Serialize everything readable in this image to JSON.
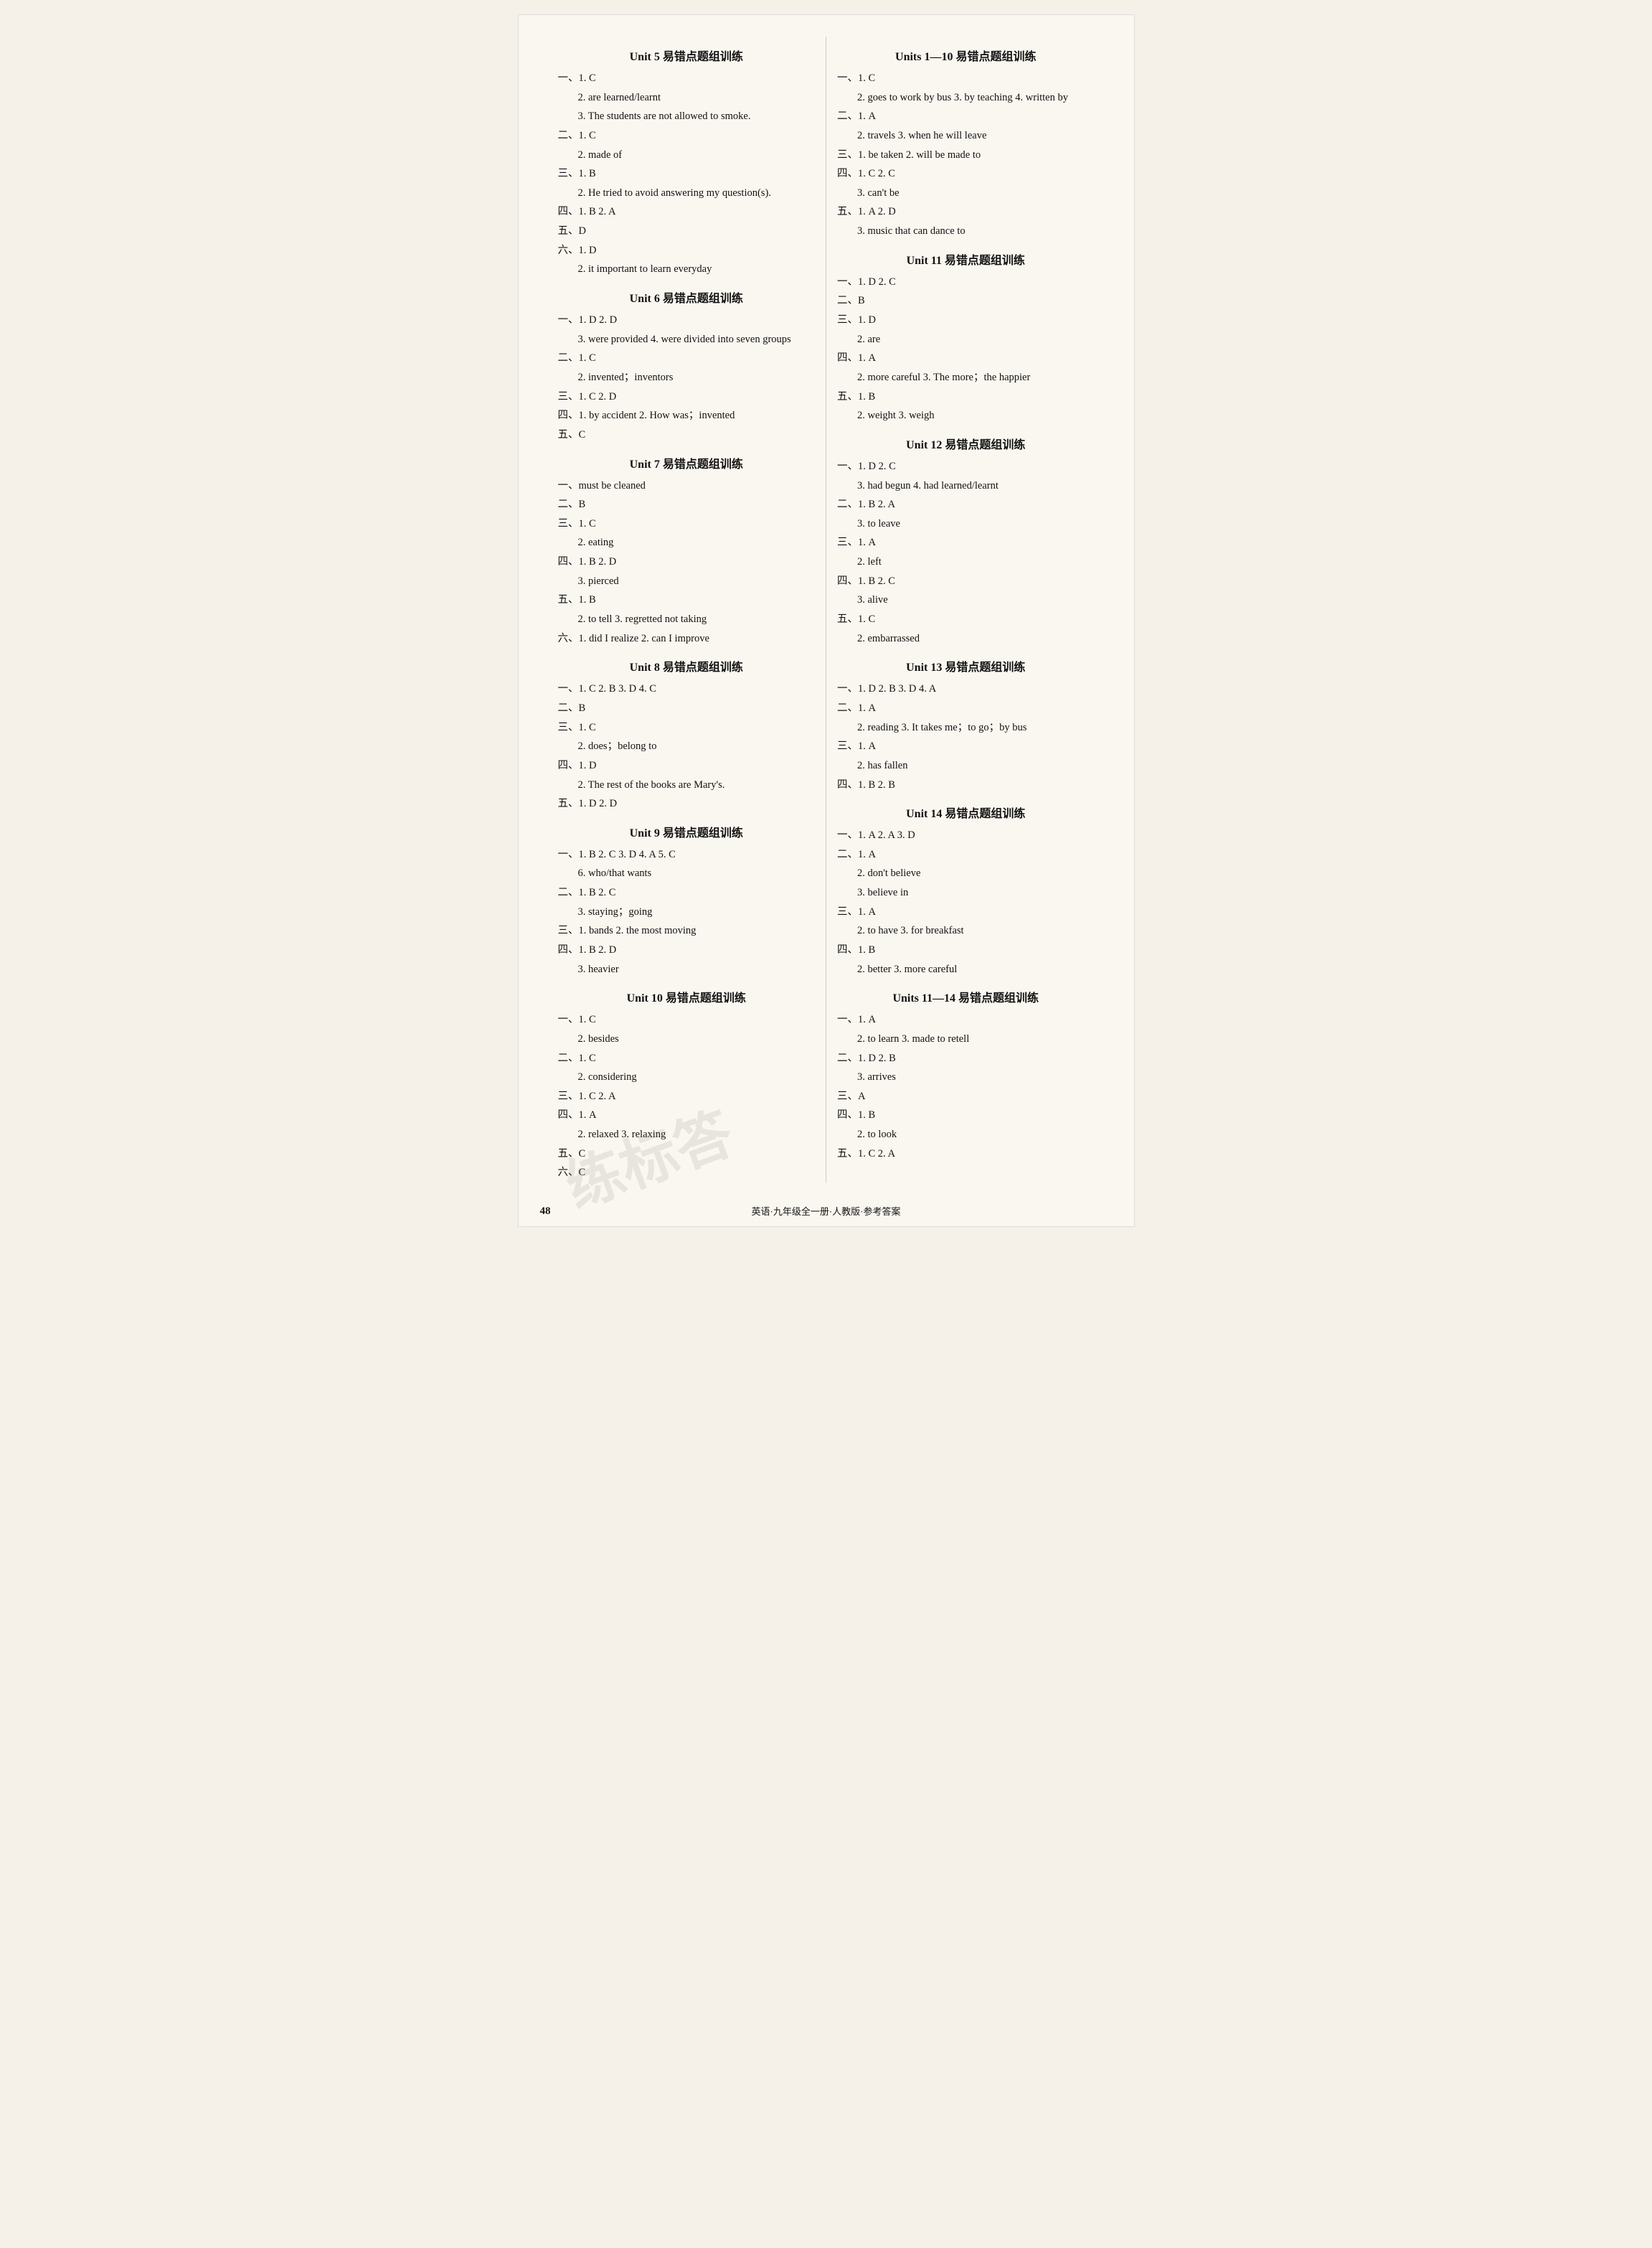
{
  "page": {
    "number": "48",
    "footer": "英语·九年级全一册·人教版·参考答案"
  },
  "left_column": {
    "sections": [
      {
        "title": "Unit 5 易错点题组训练",
        "entries": [
          "一、1. C",
          "2. are learned/learnt",
          "3. The students are not allowed to smoke.",
          "二、1. C",
          "2. made of",
          "三、1. B",
          "2. He tried to avoid answering my question(s).",
          "四、1. B  2. A",
          "五、D",
          "六、1. D",
          "2. it important to learn everyday"
        ]
      },
      {
        "title": "Unit 6 易错点题组训练",
        "entries": [
          "一、1. D  2. D",
          "3. were provided  4. were divided into seven groups",
          "二、1. C",
          "2. invented；inventors",
          "三、1. C  2. D",
          "四、1. by accident  2. How was；invented",
          "五、C"
        ]
      },
      {
        "title": "Unit 7 易错点题组训练",
        "entries": [
          "一、must be cleaned",
          "二、B",
          "三、1. C",
          "2. eating",
          "四、1. B  2. D",
          "3. pierced",
          "五、1. B",
          "2. to tell  3. regretted not taking",
          "六、1. did I realize  2. can I improve"
        ]
      },
      {
        "title": "Unit 8 易错点题组训练",
        "entries": [
          "一、1. C  2. B  3. D  4. C",
          "二、B",
          "三、1. C",
          "2. does；belong to",
          "四、1. D",
          "2. The rest of the books are Mary's.",
          "五、1. D  2. D"
        ]
      },
      {
        "title": "Unit 9 易错点题组训练",
        "entries": [
          "一、1. B  2. C  3. D  4. A  5. C",
          "6. who/that wants",
          "二、1. B  2. C",
          "3. staying；going",
          "三、1. bands  2. the most moving",
          "四、1. B  2. D",
          "3. heavier"
        ]
      },
      {
        "title": "Unit 10 易错点题组训练",
        "entries": [
          "一、1. C",
          "2. besides",
          "二、1. C",
          "2. considering",
          "三、1. C  2. A",
          "四、1. A",
          "2. relaxed  3. relaxing",
          "五、C",
          "六、C"
        ]
      }
    ]
  },
  "right_column": {
    "sections": [
      {
        "title": "Units 1—10 易错点题组训练",
        "entries": [
          "一、1. C",
          "2. goes to work by bus  3. by teaching  4. written by",
          "二、1. A",
          "2. travels  3. when he will leave",
          "三、1. be taken  2. will be made to",
          "四、1. C  2. C",
          "3. can't be",
          "五、1. A  2. D",
          "3. music that can dance to"
        ]
      },
      {
        "title": "Unit 11 易错点题组训练",
        "entries": [
          "一、1. D  2. C",
          "二、B",
          "三、1. D",
          "2. are",
          "四、1. A",
          "2. more careful  3. The more；the happier",
          "五、1. B",
          "2. weight  3. weigh"
        ]
      },
      {
        "title": "Unit 12 易错点题组训练",
        "entries": [
          "一、1. D  2. C",
          "3. had begun  4. had learned/learnt",
          "二、1. B  2. A",
          "3. to leave",
          "三、1. A",
          "2. left",
          "四、1. B  2. C",
          "3. alive",
          "五、1. C",
          "2. embarrassed"
        ]
      },
      {
        "title": "Unit 13 易错点题组训练",
        "entries": [
          "一、1. D  2. B  3. D  4. A",
          "二、1. A",
          "2. reading  3. It takes me；to go；by bus",
          "三、1. A",
          "2. has fallen",
          "四、1. B  2. B"
        ]
      },
      {
        "title": "Unit 14 易错点题组训练",
        "entries": [
          "一、1. A  2. A  3. D",
          "二、1. A",
          "2. don't believe",
          "3. believe in",
          "三、1. A",
          "2. to have  3. for breakfast",
          "四、1. B",
          "2. better  3. more careful"
        ]
      },
      {
        "title": "Units 11—14 易错点题组训练",
        "entries": [
          "一、1. A",
          "2. to learn  3. made to retell",
          "二、1. D  2. B",
          "3. arrives",
          "三、A",
          "四、1. B",
          "2. to look",
          "五、1. C  2. A"
        ]
      }
    ]
  }
}
